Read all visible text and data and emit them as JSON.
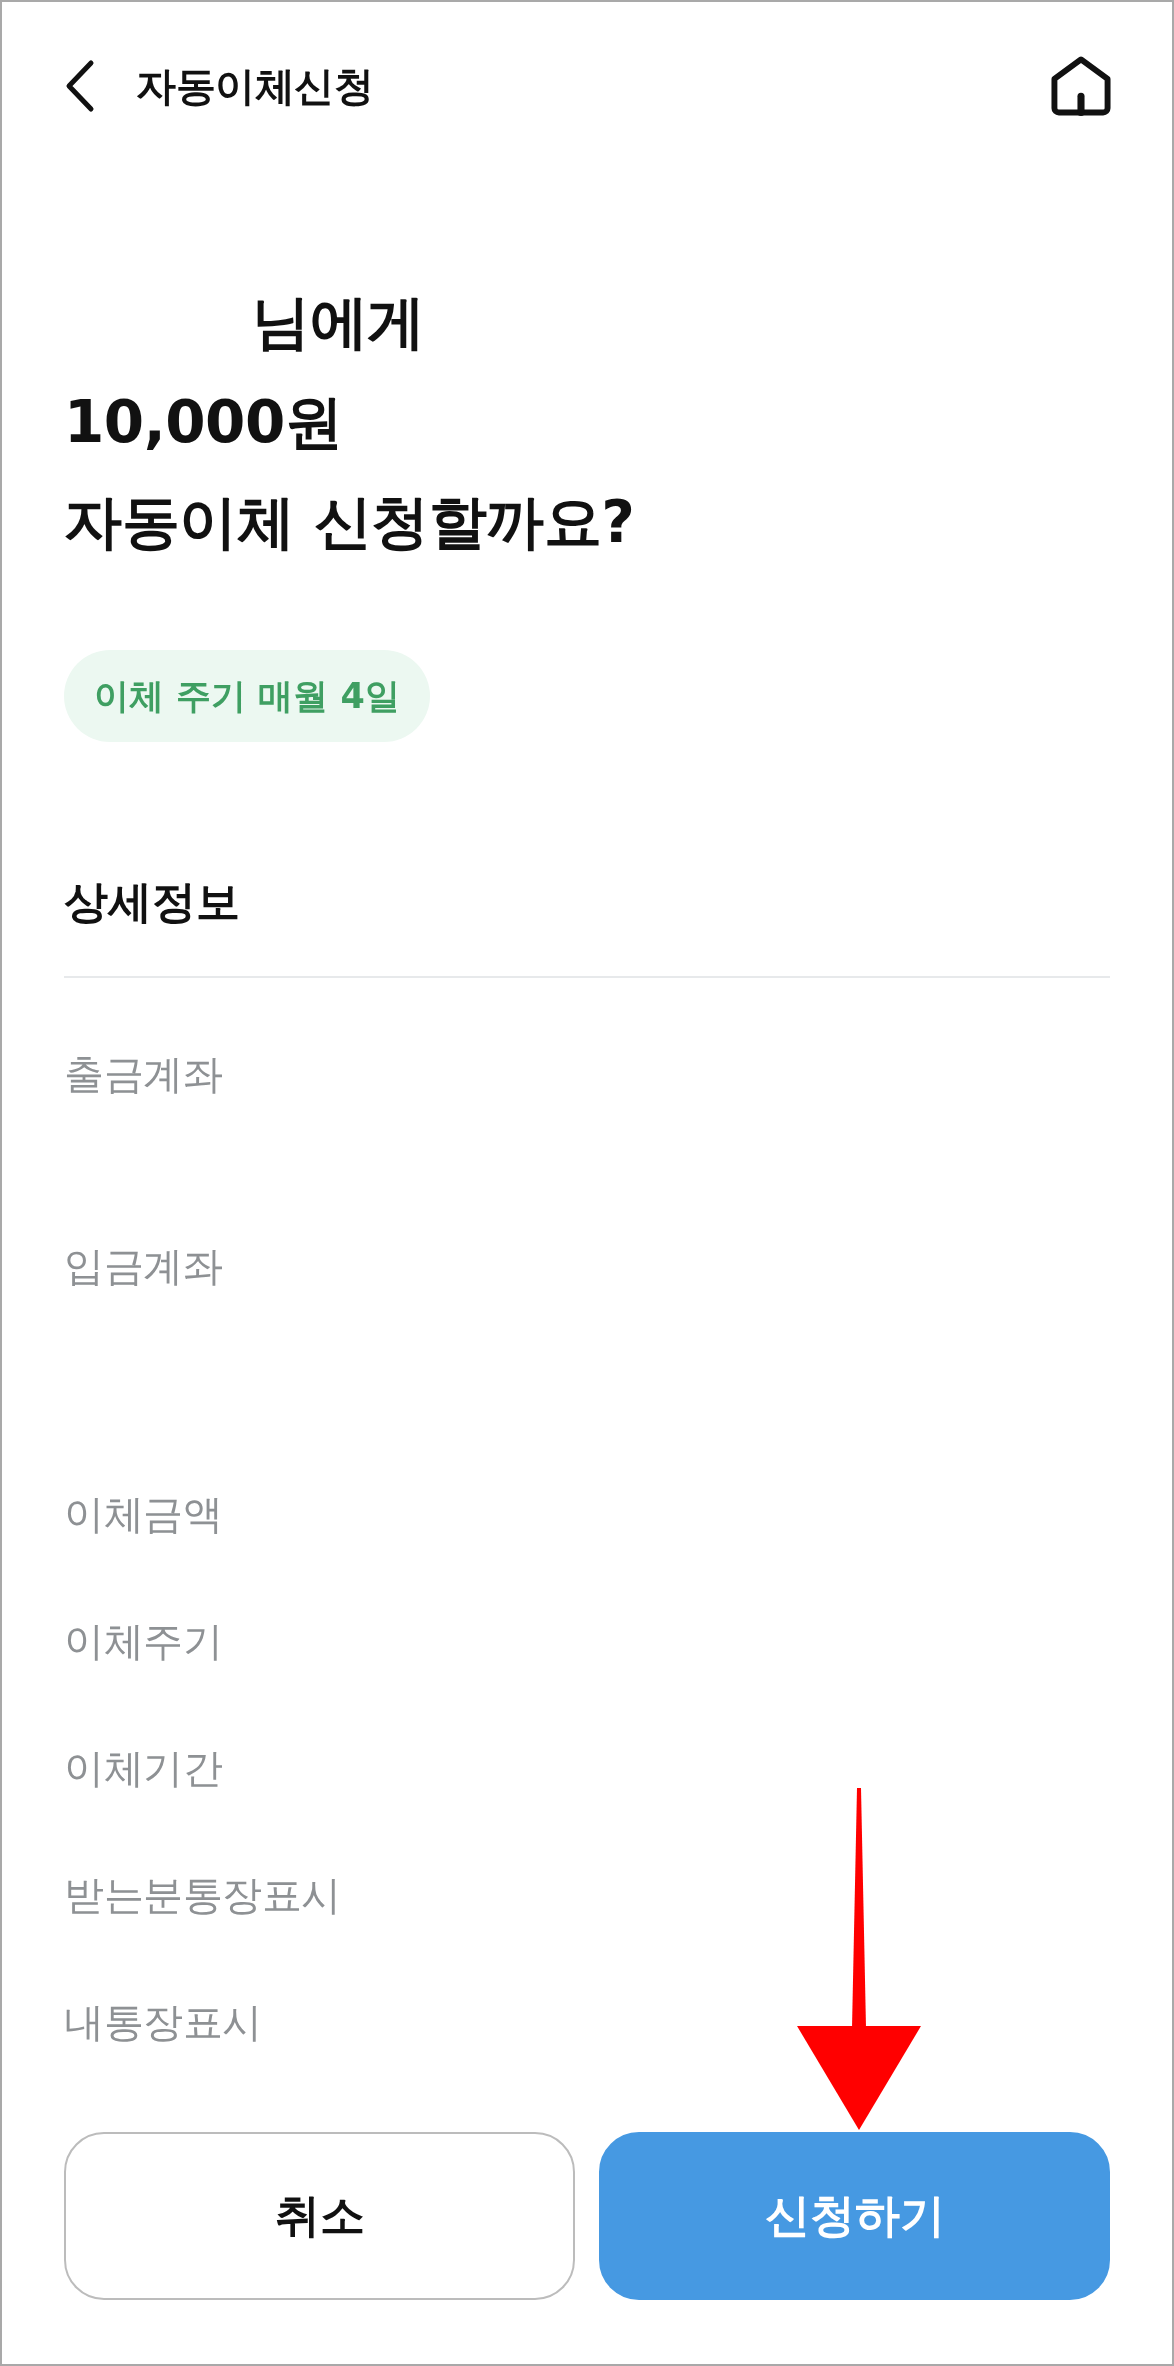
{
  "header": {
    "title": "자동이체신청"
  },
  "headline": {
    "recipient_suffix": "님에게",
    "amount": "10,000원",
    "question": "자동이체 신청할까요?"
  },
  "cycle_chip": {
    "label": "이체 주기 매월 4일"
  },
  "details": {
    "title": "상세정보",
    "rows": [
      {
        "label": "출금계좌"
      },
      {
        "label": "입금계좌"
      },
      {
        "label": "이체금액"
      },
      {
        "label": "이체주기"
      },
      {
        "label": "이체기간"
      },
      {
        "label": "받는분통장표시"
      },
      {
        "label": "내통장표시"
      }
    ]
  },
  "buttons": [
    {
      "label": "취소",
      "kind": "secondary"
    },
    {
      "label": "신청하기",
      "kind": "primary"
    }
  ],
  "annotation": {
    "kind": "arrow-down"
  }
}
